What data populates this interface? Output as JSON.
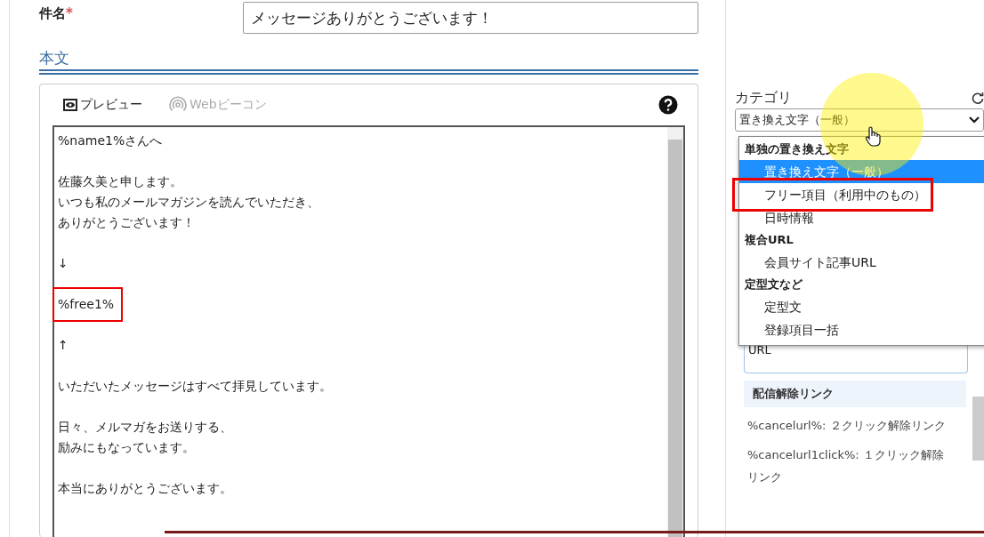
{
  "subject": {
    "label": "件名",
    "required_mark": "*",
    "value": "メッセージありがとうございます！"
  },
  "body": {
    "heading": "本文",
    "toolbar": [
      {
        "label": "プレビュー",
        "kind": "preview",
        "disabled": false
      },
      {
        "label": "Webビーコン",
        "kind": "beacon",
        "disabled": true
      }
    ],
    "paragraphs": [
      {
        "lines": [
          "%name1%さんへ"
        ],
        "highlighted": false
      },
      {
        "lines": [
          "佐藤久美と申します。",
          "いつも私のメールマガジンを読んでいただき、",
          "ありがとうございます！"
        ],
        "highlighted": false
      },
      {
        "lines": [
          "↓"
        ],
        "highlighted": false
      },
      {
        "lines": [
          "%free1%"
        ],
        "highlighted": true
      },
      {
        "lines": [
          "↑"
        ],
        "highlighted": false
      },
      {
        "lines": [
          "いただいたメッセージはすべて拝見しています。"
        ],
        "highlighted": false
      },
      {
        "lines": [
          "日々、メルマガをお送りする、",
          "励みにもなっています。"
        ],
        "highlighted": false
      },
      {
        "lines": [
          "本当にありがとうございます。"
        ],
        "highlighted": false
      }
    ]
  },
  "category": {
    "label": "カテゴリ",
    "select_value": "置き換え文字（一般）",
    "options": [
      {
        "kind": "group",
        "label": "単独の置き換え文字"
      },
      {
        "kind": "option",
        "label": "置き換え文字（一般）",
        "selected": true,
        "highlighted": false
      },
      {
        "kind": "option",
        "label": "フリー項目（利用中のもの）",
        "selected": false,
        "highlighted": true
      },
      {
        "kind": "option",
        "label": "日時情報",
        "selected": false,
        "highlighted": false
      },
      {
        "kind": "group",
        "label": "複合URL"
      },
      {
        "kind": "option",
        "label": "会員サイト記事URL",
        "selected": false,
        "highlighted": false
      },
      {
        "kind": "group",
        "label": "定型文など"
      },
      {
        "kind": "option",
        "label": "定型文",
        "selected": false,
        "highlighted": false
      },
      {
        "kind": "option",
        "label": "登録項目一括",
        "selected": false,
        "highlighted": false
      }
    ],
    "url_item": "URL",
    "section": "配信解除リンク",
    "items": [
      "%cancelurl%: ２クリック解除リンク",
      "%cancelurl1click%: １クリック解除リンク"
    ]
  }
}
